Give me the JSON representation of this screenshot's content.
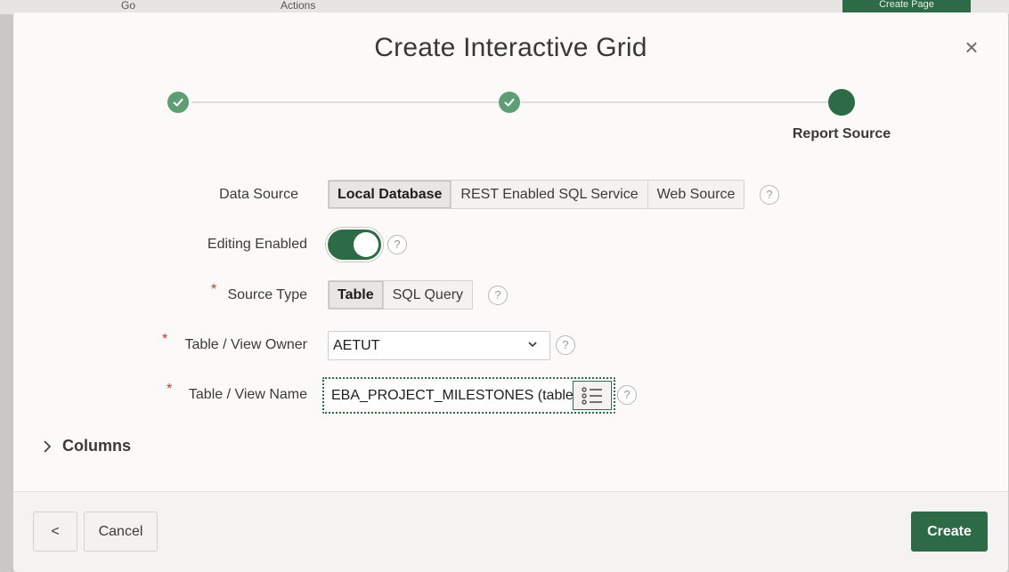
{
  "background": {
    "toolbar_items": [
      "Go",
      "Actions"
    ],
    "create_page_label": "Create Page"
  },
  "dialog": {
    "title": "Create Interactive Grid",
    "close_label": "×"
  },
  "wizard": {
    "steps": [
      {
        "status": "complete",
        "label": ""
      },
      {
        "status": "complete",
        "label": ""
      },
      {
        "status": "current",
        "label": "Report Source"
      }
    ]
  },
  "form": {
    "data_source": {
      "label": "Data Source",
      "options": [
        "Local Database",
        "REST Enabled SQL Service",
        "Web Source"
      ],
      "selected": "Local Database"
    },
    "editing_enabled": {
      "label": "Editing Enabled",
      "value": "on"
    },
    "source_type": {
      "label": "Source Type",
      "required": true,
      "options": [
        "Table",
        "SQL Query"
      ],
      "selected": "Table"
    },
    "table_view_owner": {
      "label": "Table / View Owner",
      "required": true,
      "value": "AETUT"
    },
    "table_view_name": {
      "label": "Table / View Name",
      "required": true,
      "value": "EBA_PROJECT_MILESTONES (table"
    },
    "required_marker": "*",
    "help_glyph": "?"
  },
  "columns_section": {
    "label": "Columns",
    "expanded": false
  },
  "footer": {
    "back_label": "<",
    "cancel_label": "Cancel",
    "create_label": "Create"
  },
  "colors": {
    "accent": "#2d6b46",
    "complete_step": "#5d9e74",
    "required": "#c2362a"
  }
}
